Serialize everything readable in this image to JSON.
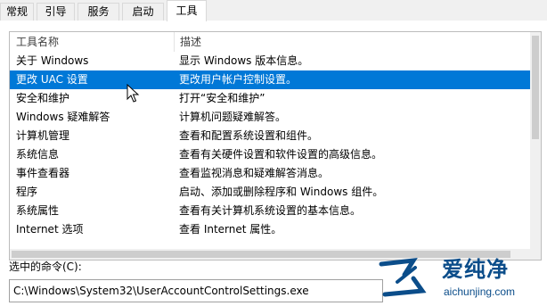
{
  "tabs": [
    "常规",
    "引导",
    "服务",
    "启动",
    "工具"
  ],
  "active_tab": "工具",
  "columns": {
    "name": "工具名称",
    "description": "描述"
  },
  "rows": [
    {
      "name": "关于 Windows",
      "description": "显示 Windows 版本信息。"
    },
    {
      "name": "更改 UAC 设置",
      "description": "更改用户帐户控制设置。"
    },
    {
      "name": "安全和维护",
      "description": "打开“安全和维护”"
    },
    {
      "name": "Windows 疑难解答",
      "description": "计算机问题疑难解答。"
    },
    {
      "name": "计算机管理",
      "description": "查看和配置系统设置和组件。"
    },
    {
      "name": "系统信息",
      "description": "查看有关硬件设置和软件设置的高级信息。"
    },
    {
      "name": "事件查看器",
      "description": "查看监视消息和疑难解答消息。"
    },
    {
      "name": "程序",
      "description": "启动、添加或删除程序和 Windows 组件。"
    },
    {
      "name": "系统属性",
      "description": "查看有关计算机系统设置的基本信息。"
    },
    {
      "name": "Internet 选项",
      "description": "查看 Internet 属性。"
    }
  ],
  "selected_row": 1,
  "selected_command": {
    "label": "选中的命令(C):",
    "value": "C:\\Windows\\System32\\UserAccountControlSettings.exe"
  },
  "watermark": {
    "brand": "爱纯净",
    "url": "aichunjing.com"
  },
  "colors": {
    "selection": "#0078d7",
    "watermark": "#0b4d8a"
  }
}
